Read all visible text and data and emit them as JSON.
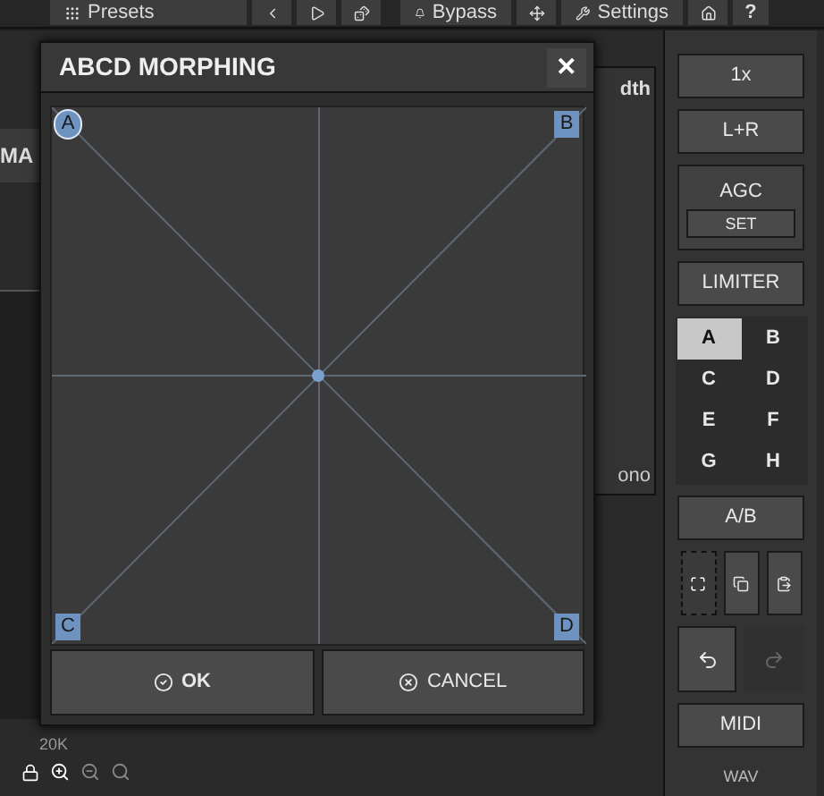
{
  "toolbar": {
    "items": [
      {
        "kind": "presets",
        "label": "Presets"
      },
      {
        "kind": "prev"
      },
      {
        "kind": "next"
      },
      {
        "kind": "random"
      },
      {
        "kind": "bypass",
        "label": "Bypass"
      },
      {
        "kind": "move"
      },
      {
        "kind": "settings",
        "label": "Settings"
      },
      {
        "kind": "home"
      },
      {
        "kind": "help",
        "label": "?"
      }
    ]
  },
  "background": {
    "left_label": "MA",
    "panel_label": "dth",
    "mode_label": "ono",
    "freq_label": "20K"
  },
  "dialog": {
    "title": "ABCD MORPHING",
    "close": "✕",
    "corners": [
      {
        "label": "A",
        "selected": true
      },
      {
        "label": "B",
        "selected": false
      },
      {
        "label": "C",
        "selected": false
      },
      {
        "label": "D",
        "selected": false
      }
    ],
    "buttons": [
      {
        "kind": "ok",
        "label": "OK"
      },
      {
        "kind": "cancel",
        "label": "CANCEL"
      }
    ]
  },
  "sidebar": {
    "oversampling": "1x",
    "channels": "L+R",
    "agc": {
      "label": "AGC",
      "button": "SET"
    },
    "limiter": "LIMITER",
    "slots": [
      {
        "label": "A",
        "selected": true
      },
      {
        "label": "B",
        "selected": false
      },
      {
        "label": "C",
        "selected": false
      },
      {
        "label": "D",
        "selected": false
      },
      {
        "label": "E",
        "selected": false
      },
      {
        "label": "F",
        "selected": false
      },
      {
        "label": "G",
        "selected": false
      },
      {
        "label": "H",
        "selected": false
      }
    ],
    "ab": "A/B",
    "midi": "MIDI",
    "format": "WAV"
  }
}
